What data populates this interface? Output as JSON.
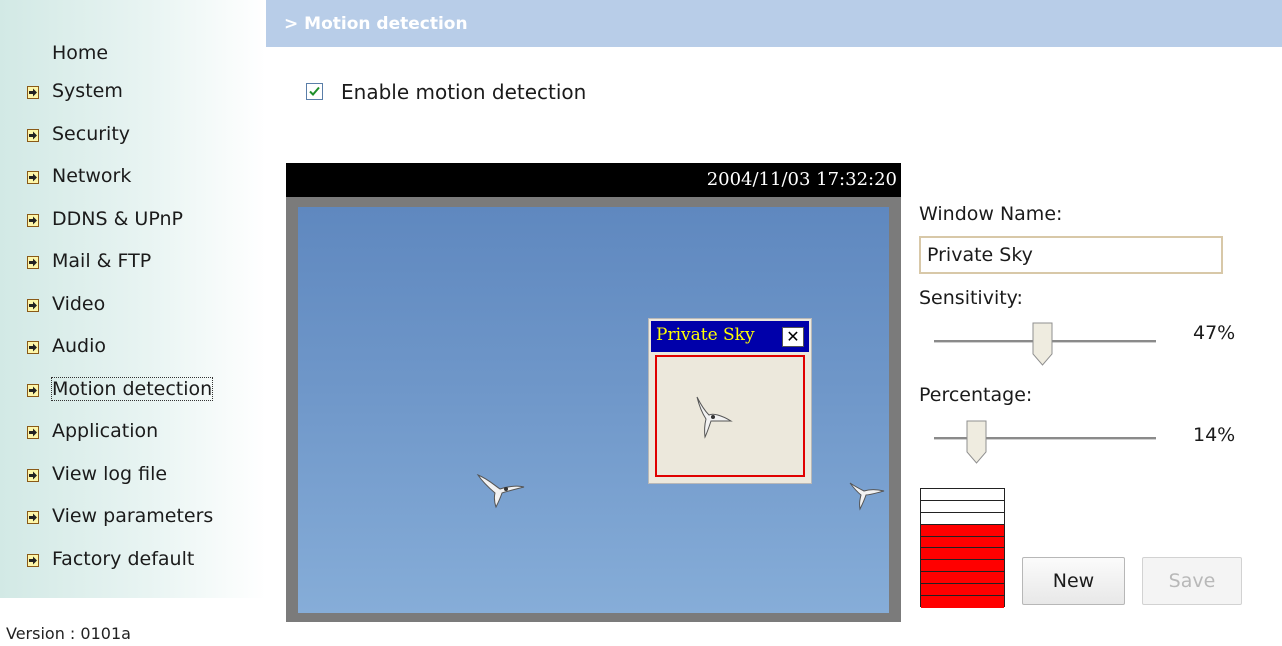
{
  "sidebar": {
    "home": "Home",
    "items": [
      {
        "label": "System"
      },
      {
        "label": "Security"
      },
      {
        "label": "Network"
      },
      {
        "label": "DDNS & UPnP"
      },
      {
        "label": "Mail & FTP"
      },
      {
        "label": "Video"
      },
      {
        "label": "Audio"
      },
      {
        "label": "Motion detection"
      },
      {
        "label": "Application"
      },
      {
        "label": "View log file"
      },
      {
        "label": "View parameters"
      },
      {
        "label": "Factory default"
      }
    ],
    "active_item": "Motion detection",
    "item_icon": "arrow-right-icon"
  },
  "version": "Version : 0101a",
  "page_title": "> Motion detection",
  "enable_checkbox": {
    "label": "Enable motion detection",
    "checked": true
  },
  "camera": {
    "timestamp": "2004/11/03 17:32:20",
    "window": {
      "name": "Private Sky",
      "close_icon": "close-icon"
    }
  },
  "settings": {
    "window_name_label": "Window Name:",
    "window_name_value": "Private Sky",
    "sensitivity_label": "Sensitivity:",
    "sensitivity_value": "47%",
    "sensitivity_level": 47,
    "percentage_label": "Percentage:",
    "percentage_value": "14%",
    "percentage_level": 14
  },
  "meter": {
    "total_segments": 10,
    "filled_segments": 7,
    "fill_color": "#ff0000"
  },
  "buttons": {
    "new_label": "New",
    "save_label": "Save",
    "save_enabled": false
  },
  "colors": {
    "title_bar": "#b8cde8",
    "window_title": "#0000aa",
    "window_title_text": "#ffff00",
    "window_border": "#e00000"
  }
}
